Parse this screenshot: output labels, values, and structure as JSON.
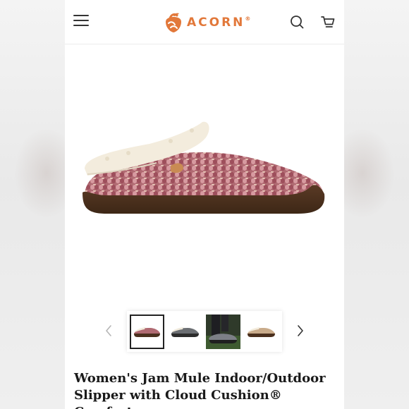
{
  "brand": {
    "name": "ACORN",
    "reg_mark": "®",
    "color": "#e2783a"
  },
  "header": {
    "menu_icon": "hamburger-icon",
    "search_icon": "search-icon",
    "cart_icon": "cart-icon"
  },
  "gallery": {
    "prev_icon": "chevron-left-icon",
    "next_icon": "chevron-right-icon",
    "thumbnails": [
      {
        "name": "pink-knit-slipper",
        "active": true
      },
      {
        "name": "grey-knit-slipper",
        "active": false
      },
      {
        "name": "slipper-on-foot-outdoors",
        "active": false
      },
      {
        "name": "tan-knit-slipper",
        "active": false
      }
    ]
  },
  "product": {
    "title_line1": "Women's Jam Mule Indoor/Outdoor",
    "title_line2": "Slipper with Cloud Cushion® Comfort"
  }
}
